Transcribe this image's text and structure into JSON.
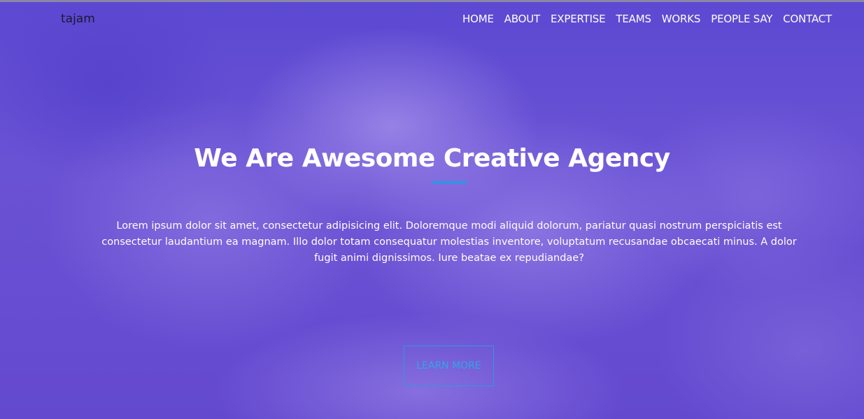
{
  "navbar": {
    "brand": "tajam",
    "items": [
      {
        "label": "HOME"
      },
      {
        "label": "ABOUT"
      },
      {
        "label": "EXPERTISE"
      },
      {
        "label": "TEAMS"
      },
      {
        "label": "WORKS"
      },
      {
        "label": "PEOPLE SAY"
      },
      {
        "label": "CONTACT"
      }
    ]
  },
  "hero": {
    "title": "We Are Awesome Creative Agency",
    "description": "Lorem ipsum dolor sit amet, consectetur adipisicing elit. Doloremque modi aliquid dolorum, pariatur quasi nostrum perspiciatis est consectetur laudantium ea magnam. Illo dolor totam consequatur molestias inventore, voluptatum recusandae obcaecati minus. A dolor fugit animi dignissimos. Iure beatae ex repudiandae?",
    "cta_label": "LEARN MORE"
  },
  "colors": {
    "background": "#5a46cf",
    "accent": "#1e9fe6",
    "text": "#ffffff",
    "brand_text": "#1d1733"
  }
}
